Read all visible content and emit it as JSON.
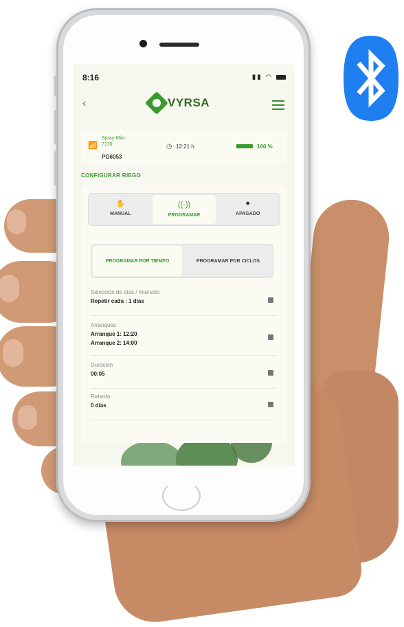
{
  "status": {
    "time": "8:16"
  },
  "brand": {
    "name": "VYRSA"
  },
  "device": {
    "name_line1": "Spray-Mist",
    "name_line2": "7170",
    "id": "PG6053",
    "time_remaining": "12:21 h",
    "battery": "100 %",
    "battery_level": 1.0
  },
  "section_title": "CONFIGURAR RIEGO",
  "mode_tabs": [
    {
      "label": "MANUAL",
      "active": false
    },
    {
      "label": "PROGRAMAR",
      "active": true
    },
    {
      "label": "APAGADO",
      "active": false
    }
  ],
  "sub_tabs": [
    {
      "label": "PROGRAMAR POR TIEMPO",
      "active": true
    },
    {
      "label": "PROGRAMAR POR CICLOS",
      "active": false
    }
  ],
  "settings": [
    {
      "label": "Selección de días / Intervalo",
      "values": [
        "Repetir cada : 1 días"
      ]
    },
    {
      "label": "Arranques",
      "values": [
        "Arranque 1: 12:20",
        "Arranque 2: 14:00"
      ]
    },
    {
      "label": "Duración",
      "values": [
        "00:05"
      ]
    },
    {
      "label": "Retardo",
      "values": [
        "0 días"
      ]
    }
  ],
  "colors": {
    "accent": "#3a9a2d",
    "bluetooth": "#1f7ef0",
    "background": "#f6f7ef"
  }
}
